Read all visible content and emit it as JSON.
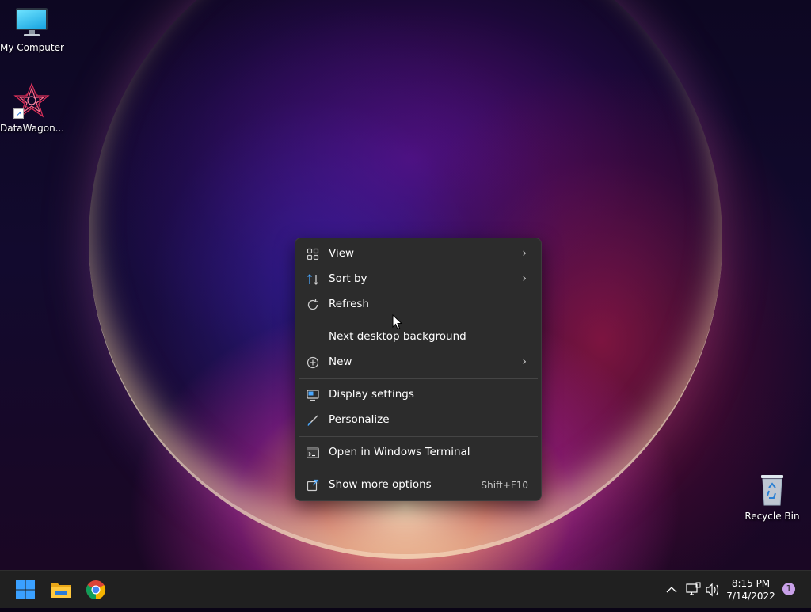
{
  "desktop": {
    "icons": [
      {
        "label": "My Computer",
        "icon": "monitor-icon"
      },
      {
        "label": "DataWagon...",
        "icon": "datawagon-app-icon"
      },
      {
        "label": "Recycle Bin",
        "icon": "recycle-bin-icon"
      }
    ]
  },
  "context_menu": {
    "items": [
      {
        "label": "View",
        "icon": "grid-view-icon",
        "submenu": true
      },
      {
        "label": "Sort by",
        "icon": "sort-icon",
        "submenu": true
      },
      {
        "label": "Refresh",
        "icon": "refresh-icon"
      },
      {
        "label": "Next desktop background"
      },
      {
        "label": "New",
        "icon": "plus-circle-icon",
        "submenu": true
      },
      {
        "label": "Display settings",
        "icon": "display-icon"
      },
      {
        "label": "Personalize",
        "icon": "brush-icon"
      },
      {
        "label": "Open in Windows Terminal",
        "icon": "terminal-icon"
      },
      {
        "label": "Show more options",
        "icon": "share-icon",
        "shortcut": "Shift+F10"
      }
    ]
  },
  "taskbar": {
    "apps": [
      "windows-start-icon",
      "file-explorer-icon",
      "chrome-icon"
    ],
    "tray": [
      "chevron-up-icon",
      "network-icon",
      "volume-icon"
    ],
    "time": "8:15 PM",
    "date": "7/14/2022",
    "notification_count": "1"
  },
  "colors": {
    "menu_bg": "#2c2c2c",
    "taskbar_bg": "#202020",
    "start_blue": "#3aa0ff"
  }
}
